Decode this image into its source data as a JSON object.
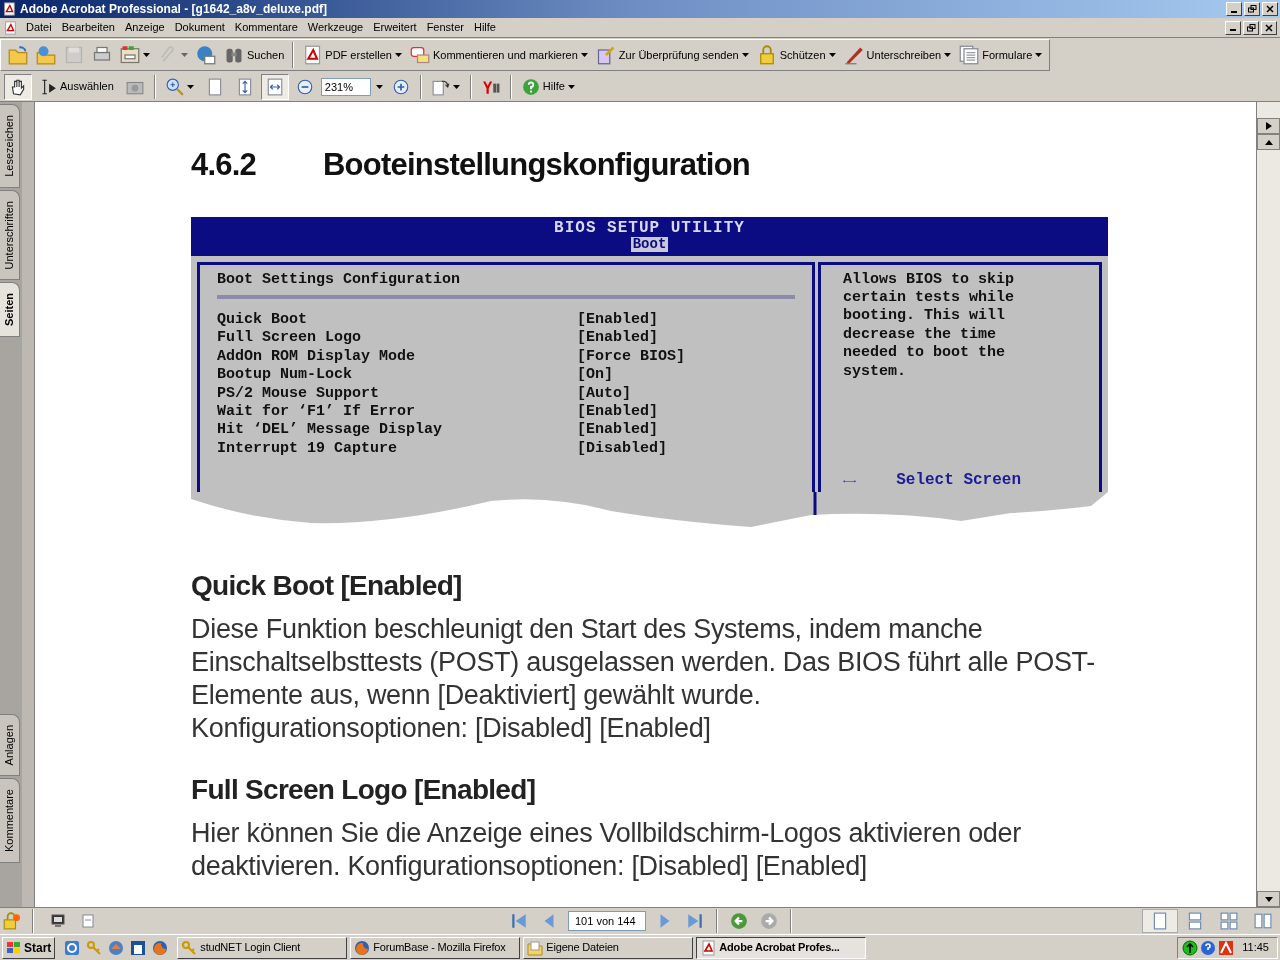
{
  "window": {
    "title": "Adobe Acrobat Professional - [g1642_a8v_deluxe.pdf]"
  },
  "menu": [
    "Datei",
    "Bearbeiten",
    "Anzeige",
    "Dokument",
    "Kommentare",
    "Werkzeuge",
    "Erweitert",
    "Fenster",
    "Hilfe"
  ],
  "toolbar_1": [
    {
      "dropdown": false,
      "disabled": false
    },
    {
      "dropdown": false,
      "disabled": false
    },
    {
      "dropdown": false,
      "disabled": true
    },
    {
      "dropdown": false,
      "disabled": false
    },
    {
      "dropdown": true,
      "disabled": false
    },
    {
      "dropdown": true,
      "disabled": true
    },
    {
      "dropdown": false,
      "disabled": false
    },
    {
      "label": "Suchen",
      "dropdown": false,
      "disabled": false
    },
    {
      "label": "PDF erstellen",
      "dropdown": true,
      "disabled": false
    },
    {
      "label": "Kommentieren und markieren",
      "dropdown": true,
      "disabled": false
    },
    {
      "label": "Zur Überprüfung senden",
      "dropdown": true,
      "disabled": false
    },
    {
      "label": "Schützen",
      "dropdown": true,
      "disabled": false
    },
    {
      "label": "Unterschreiben",
      "dropdown": true,
      "disabled": false
    },
    {
      "label": "Formulare",
      "dropdown": true,
      "disabled": false
    }
  ],
  "toolbar_2": [
    {
      "selected": true,
      "dropdown": false
    },
    {
      "label": "Auswählen",
      "selected": false,
      "dropdown": false
    },
    {
      "selected": false,
      "dropdown": false
    },
    {
      "selected": false,
      "dropdown": true
    },
    {
      "selected": false,
      "dropdown": false
    },
    {
      "selected": false,
      "dropdown": false
    },
    {
      "selected": true,
      "dropdown": false
    },
    {
      "selected": false,
      "dropdown": false
    },
    {
      "kind": "zoom",
      "value": "231%",
      "dropdown": true
    },
    {
      "selected": false,
      "dropdown": false
    },
    {
      "selected": false,
      "dropdown": true
    },
    {
      "selected": false,
      "dropdown": false
    },
    {
      "label": "Hilfe",
      "selected": false,
      "dropdown": true
    }
  ],
  "side_tabs_top": [
    {
      "label": "Lesezeichen",
      "selected": false
    },
    {
      "label": "Unterschriften",
      "selected": false
    },
    {
      "label": "Seiten",
      "selected": true
    }
  ],
  "side_tabs_bottom": [
    {
      "label": "Anlagen",
      "selected": false
    },
    {
      "label": "Kommentare",
      "selected": false
    }
  ],
  "document": {
    "heading_number": "4.6.2",
    "heading": "Booteinstellungskonfiguration",
    "bios": {
      "title": "BIOS SETUP UTILITY",
      "tab": "Boot",
      "section": "Boot Settings Configuration",
      "settings": [
        {
          "name": "Quick Boot",
          "value": "[Enabled]"
        },
        {
          "name": "Full Screen Logo",
          "value": "[Enabled]"
        },
        {
          "name": "AddOn ROM Display Mode",
          "value": "[Force BIOS]"
        },
        {
          "name": "Bootup Num-Lock",
          "value": "[On]"
        },
        {
          "name": "PS/2 Mouse Support",
          "value": "[Auto]"
        },
        {
          "name": "Wait for ‘F1’ If Error",
          "value": "[Enabled]"
        },
        {
          "name": "Hit ‘DEL’ Message Display",
          "value": "[Enabled]"
        },
        {
          "name": "Interrupt 19 Capture",
          "value": "[Disabled]"
        }
      ],
      "help": "Allows BIOS to skip certain tests while booting. This will decrease the time needed to boot the system.",
      "key_hint": {
        "key": "←→",
        "action": "Select Screen"
      }
    },
    "sections": [
      {
        "heading": "Quick Boot [Enabled]",
        "paragraphs": [
          "Diese Funktion beschleunigt den Start des Systems, indem manche Einschaltselbsttests (POST) ausgelassen werden. Das BIOS führt alle POST-Elemente aus, wenn [Deaktiviert] gewählt wurde.",
          "Konfigurationsoptionen: [Disabled] [Enabled]"
        ]
      },
      {
        "heading": "Full Screen Logo [Enabled]",
        "paragraphs": [
          "Hier können Sie die Anzeige eines Vollbildschirm-Logos aktivieren oder deaktivieren. Konfigurationsoptionen: [Disabled] [Enabled]"
        ]
      }
    ]
  },
  "status_bar": {
    "page": "101 von 144"
  },
  "taskbar": {
    "start": "Start",
    "tasks": [
      {
        "label": "studNET Login Client",
        "selected": false
      },
      {
        "label": "ForumBase - Mozilla Firefox",
        "selected": false
      },
      {
        "label": "Eigene Dateien",
        "selected": false
      },
      {
        "label": "Adobe Acrobat Profes...",
        "selected": true
      }
    ],
    "clock": "11:45"
  }
}
